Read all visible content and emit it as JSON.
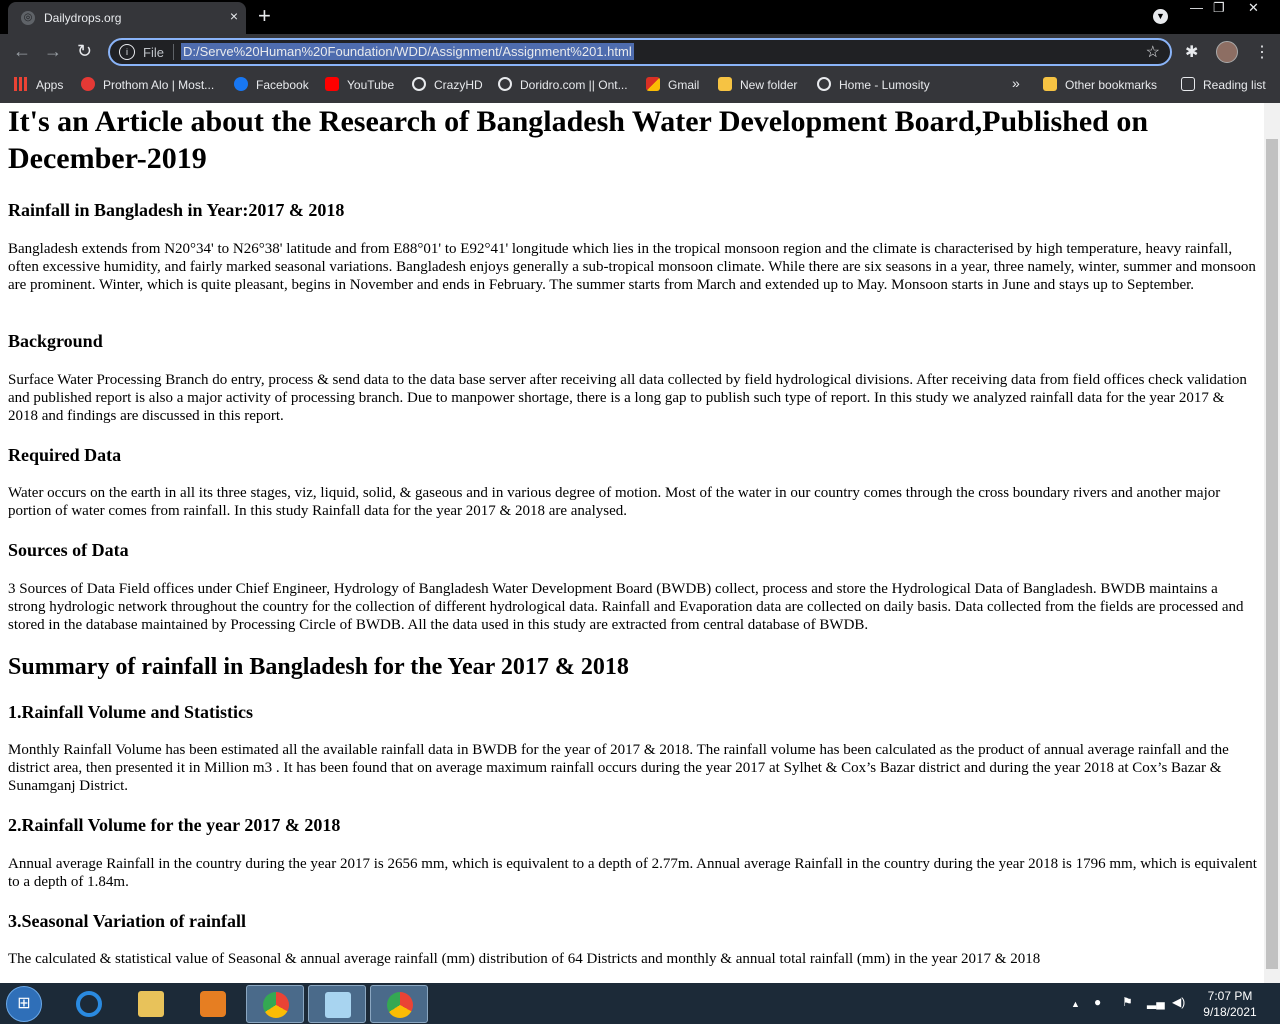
{
  "tab": {
    "title": "Dailydrops.org",
    "close": "×"
  },
  "newtab": "+",
  "window": {
    "minimize": "—",
    "restore": "❐",
    "close": "✕"
  },
  "toolbar": {
    "back": "←",
    "forward": "→",
    "reload": "↻",
    "scheme": "File",
    "url": "D:/Serve%20Human%20Foundation/WDD/Assignment/Assignment%201.html",
    "star": "☆",
    "extensions": "✱",
    "menu": "⋮"
  },
  "bookmarks": [
    {
      "label": "Apps",
      "icon": "apps-grid-icon",
      "color": "#ea4335"
    },
    {
      "label": "Prothom Alo | Most...",
      "icon": "prothom-alo-icon",
      "color": "#e53935"
    },
    {
      "label": "Facebook",
      "icon": "facebook-icon",
      "color": "#1877f2"
    },
    {
      "label": "YouTube",
      "icon": "youtube-icon",
      "color": "#ff0000"
    },
    {
      "label": "CrazyHD",
      "icon": "globe-icon",
      "color": "#e8eaed"
    },
    {
      "label": "Doridro.com || Ont...",
      "icon": "globe-icon",
      "color": "#e8eaed"
    },
    {
      "label": "Gmail",
      "icon": "gmail-icon",
      "color": "#d93025"
    },
    {
      "label": "New folder",
      "icon": "folder-icon",
      "color": "#f6c343"
    },
    {
      "label": "Home - Lumosity",
      "icon": "globe-icon",
      "color": "#e8eaed"
    }
  ],
  "bookmarks_more": "»",
  "other_bookmarks": "Other bookmarks",
  "reading_list": "Reading list",
  "article": {
    "title": "It's an Article about the Research of Bangladesh Water Development Board,Published on December-2019",
    "s1_heading": "Rainfall in Bangladesh in Year:2017 & 2018",
    "s1_text": "Bangladesh extends from N20°34' to N26°38' latitude and from E88°01' to E92°41' longitude which lies in the tropical monsoon region and the climate is characterised by high temperature, heavy rainfall, often excessive humidity, and fairly marked seasonal variations. Bangladesh enjoys generally a sub-tropical monsoon climate. While there are six seasons in a year, three namely, winter, summer and monsoon are prominent. Winter, which is quite pleasant, begins in November and ends in February. The summer starts from March and extended up to May. Monsoon starts in June and stays up to September.",
    "s2_heading": "Background",
    "s2_text": "Surface Water Processing Branch do entry, process & send data to the data base server after receiving all data collected by field hydrological divisions. After receiving data from field offices check validation and published report is also a major activity of processing branch. Due to manpower shortage, there is a long gap to publish such type of report. In this study we analyzed rainfall data for the year 2017 & 2018 and findings are discussed in this report.",
    "s3_heading": "Required Data",
    "s3_text": "Water occurs on the earth in all its three stages, viz, liquid, solid, & gaseous and in various degree of motion. Most of the water in our country comes through the cross boundary rivers and another major portion of water comes from rainfall. In this study Rainfall data for the year 2017 & 2018 are analysed.",
    "s4_heading": "Sources of Data",
    "s4_text": "3 Sources of Data Field offices under Chief Engineer, Hydrology of Bangladesh Water Development Board (BWDB) collect, process and store the Hydrological Data of Bangladesh. BWDB maintains a strong hydrologic network throughout the country for the collection of different hydrological data. Rainfall and Evaporation data are collected on daily basis. Data collected from the fields are processed and stored in the database maintained by Processing Circle of BWDB. All the data used in this study are extracted from central database of BWDB.",
    "summary_heading": "Summary of rainfall in Bangladesh for the Year 2017 & 2018",
    "s5_heading": "1.Rainfall Volume and Statistics",
    "s5_text": "Monthly Rainfall Volume has been estimated all the available rainfall data in BWDB for the year of 2017 & 2018. The rainfall volume has been calculated as the product of annual average rainfall and the district area, then presented it in Million m3 . It has been found that on average maximum rainfall occurs during the year 2017 at Sylhet & Cox’s Bazar district and during the year 2018 at Cox’s Bazar & Sunamganj District.",
    "s6_heading": "2.Rainfall Volume for the year 2017 & 2018",
    "s6_text": "Annual average Rainfall in the country during the year 2017 is 2656 mm, which is equivalent to a depth of 2.77m. Annual average Rainfall in the country during the year 2018 is 1796 mm, which is equivalent to a depth of 1.84m.",
    "s7_heading": "3.Seasonal Variation of rainfall",
    "s7_text": "The calculated & statistical value of Seasonal & annual average rainfall (mm) distribution of 64 Districts and monthly & annual total rainfall (mm) in the year 2017 & 2018"
  },
  "taskbar": {
    "start_icon": "windows-logo-icon",
    "tray_up": "▲",
    "clock_time": "7:07 PM",
    "clock_date": "9/18/2021"
  }
}
